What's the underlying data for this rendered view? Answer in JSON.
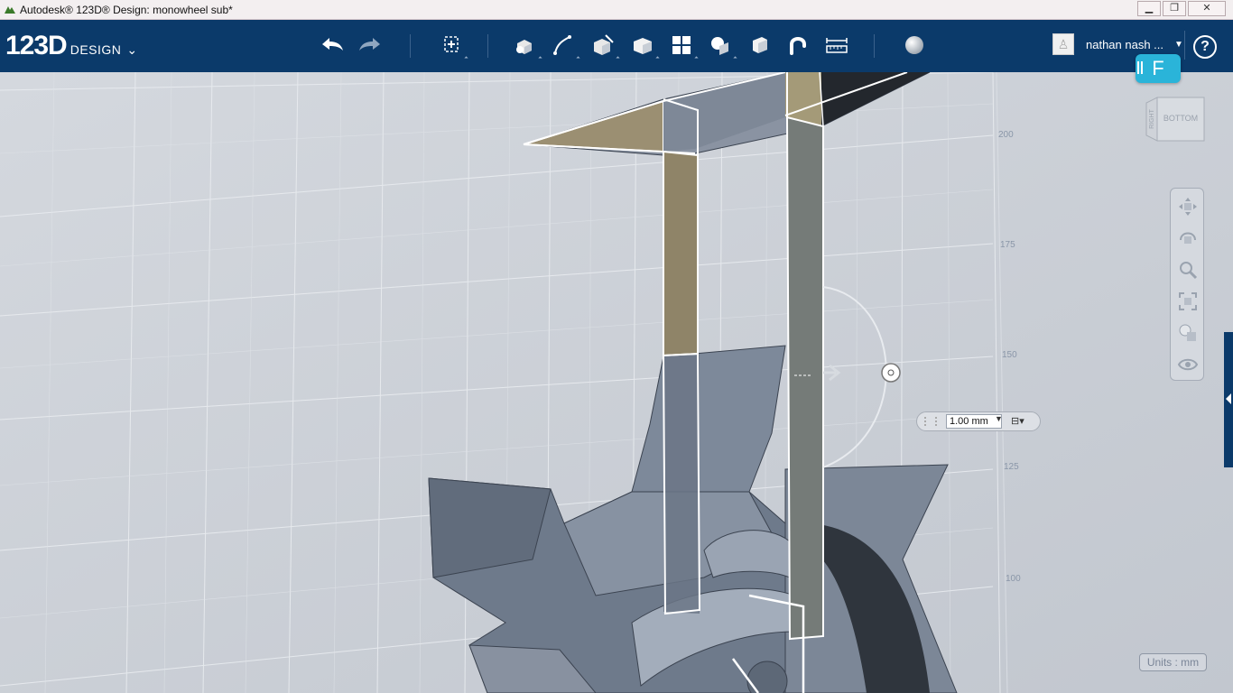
{
  "window": {
    "title": "Autodesk® 123D® Design: monowheel sub*",
    "minimize": "▁",
    "maximize": "❐",
    "close": "✕"
  },
  "toolbar": {
    "logo_main": "123D",
    "logo_sub": "DESIGN",
    "logo_chevron": "⌄",
    "tools": [
      {
        "name": "undo-icon"
      },
      {
        "name": "redo-icon"
      },
      {
        "name": "transform-icon"
      },
      {
        "name": "primitives-icon"
      },
      {
        "name": "sketch-icon"
      },
      {
        "name": "construct-icon"
      },
      {
        "name": "modify-icon"
      },
      {
        "name": "pattern-icon"
      },
      {
        "name": "grouping-icon"
      },
      {
        "name": "combine-icon"
      },
      {
        "name": "snap-icon"
      },
      {
        "name": "measure-icon"
      },
      {
        "name": "material-icon"
      }
    ]
  },
  "user": {
    "avatar": "♙",
    "name": "nathan nash ...",
    "caret": "▼",
    "help": "?"
  },
  "viewcube": {
    "left_face": "RIGHT",
    "front_face": "BOTTOM"
  },
  "f_badge": "F",
  "measure": {
    "value": "1.00 mm",
    "caret": "▼",
    "snap_caret": "▾"
  },
  "ruler": {
    "labels": [
      "200",
      "175",
      "150",
      "125",
      "100"
    ]
  },
  "units_label": "Units : mm",
  "colors": {
    "toolbar_bg": "#0b3a6a",
    "viewport_bg": "#c8ccd4",
    "accent": "#2ab4d9"
  }
}
